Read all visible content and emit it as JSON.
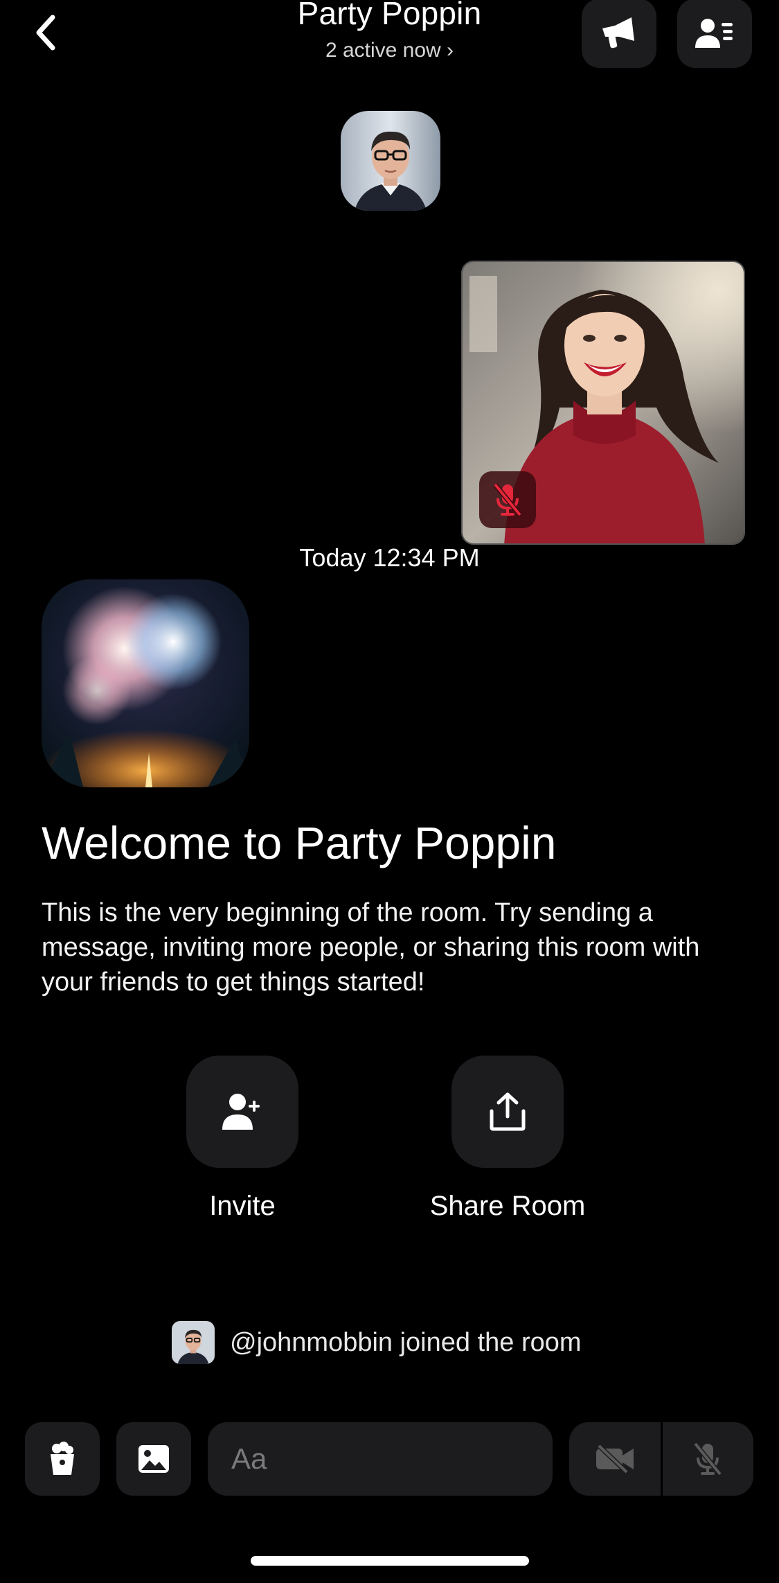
{
  "header": {
    "title": "Party Poppin",
    "subtitle": "2 active now ›",
    "back_icon": "chevron-left-icon",
    "announce_icon": "megaphone-icon",
    "members_icon": "member-list-icon"
  },
  "stage": {
    "timestamp": "Today 12:34 PM",
    "mute_icon": "microphone-off-icon",
    "mute_color": "#e5263b"
  },
  "welcome": {
    "title": "Welcome to Party Poppin",
    "description": "This is the very beginning of the room. Try sending a message, inviting more people, or sharing this room with your friends to get things started!"
  },
  "actions": {
    "invite_label": "Invite",
    "share_label": "Share Room"
  },
  "activity": {
    "join_text": "@johnmobbin joined the room"
  },
  "composer": {
    "placeholder": "Aa",
    "icons": [
      "popcorn-icon",
      "image-icon",
      "emoji-icon",
      "video-off-icon",
      "microphone-off-icon"
    ]
  },
  "colors": {
    "background": "#000000",
    "surface": "#1c1c1e",
    "disabled_icon": "#5a5a5a"
  }
}
